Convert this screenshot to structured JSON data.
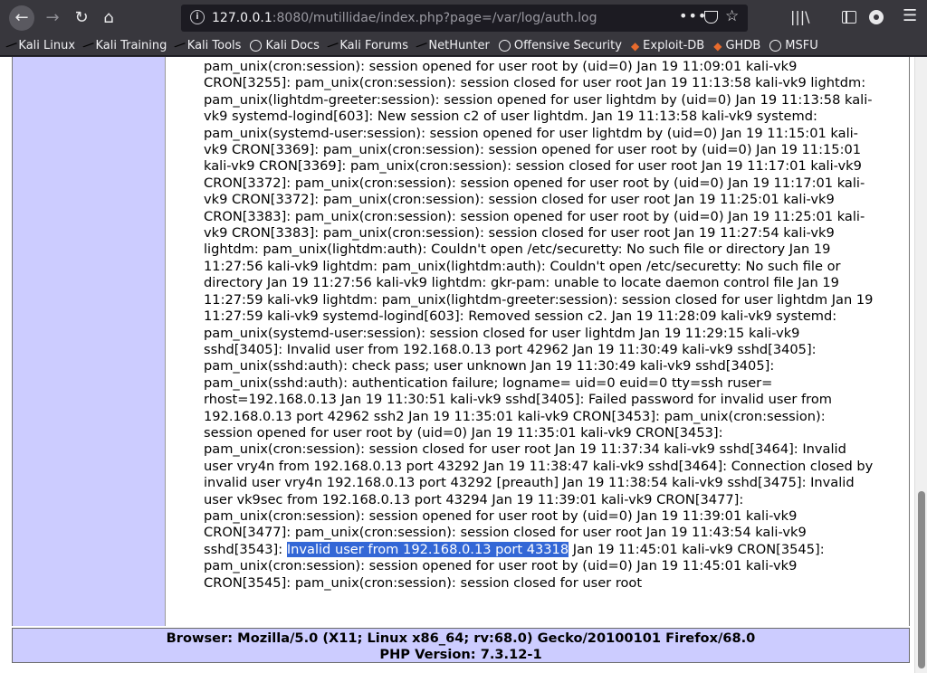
{
  "browser": {
    "url_host": "127.0.0.1",
    "url_rest": ":8080/mutillidae/index.php?page=/var/log/auth.log",
    "more_label": "•••"
  },
  "bookmarks": [
    {
      "label": "Kali Linux",
      "icon": "kali-dragon-icon"
    },
    {
      "label": "Kali Training",
      "icon": "kali-dragon-icon"
    },
    {
      "label": "Kali Tools",
      "icon": "kali-dragon-icon"
    },
    {
      "label": "Kali Docs",
      "icon": "globe-icon"
    },
    {
      "label": "Kali Forums",
      "icon": "kali-dragon-icon"
    },
    {
      "label": "NetHunter",
      "icon": "kali-dragon-icon"
    },
    {
      "label": "Offensive Security",
      "icon": "globe-icon"
    },
    {
      "label": "Exploit-DB",
      "icon": "exploit-db-icon"
    },
    {
      "label": "GHDB",
      "icon": "exploit-db-icon"
    },
    {
      "label": "MSFU",
      "icon": "globe-icon"
    }
  ],
  "log": {
    "before_highlight": "pam_unix(cron:session): session opened for user root by (uid=0) Jan 19 11:09:01 kali-vk9 CRON[3255]: pam_unix(cron:session): session closed for user root Jan 19 11:13:58 kali-vk9 lightdm: pam_unix(lightdm-greeter:session): session opened for user lightdm by (uid=0) Jan 19 11:13:58 kali-vk9 systemd-logind[603]: New session c2 of user lightdm. Jan 19 11:13:58 kali-vk9 systemd: pam_unix(systemd-user:session): session opened for user lightdm by (uid=0) Jan 19 11:15:01 kali-vk9 CRON[3369]: pam_unix(cron:session): session opened for user root by (uid=0) Jan 19 11:15:01 kali-vk9 CRON[3369]: pam_unix(cron:session): session closed for user root Jan 19 11:17:01 kali-vk9 CRON[3372]: pam_unix(cron:session): session opened for user root by (uid=0) Jan 19 11:17:01 kali-vk9 CRON[3372]: pam_unix(cron:session): session closed for user root Jan 19 11:25:01 kali-vk9 CRON[3383]: pam_unix(cron:session): session opened for user root by (uid=0) Jan 19 11:25:01 kali-vk9 CRON[3383]: pam_unix(cron:session): session closed for user root Jan 19 11:27:54 kali-vk9 lightdm: pam_unix(lightdm:auth): Couldn't open /etc/securetty: No such file or directory Jan 19 11:27:56 kali-vk9 lightdm: pam_unix(lightdm:auth): Couldn't open /etc/securetty: No such file or directory Jan 19 11:27:56 kali-vk9 lightdm: gkr-pam: unable to locate daemon control file Jan 19 11:27:59 kali-vk9 lightdm: pam_unix(lightdm-greeter:session): session closed for user lightdm Jan 19 11:27:59 kali-vk9 systemd-logind[603]: Removed session c2. Jan 19 11:28:09 kali-vk9 systemd: pam_unix(systemd-user:session): session closed for user lightdm Jan 19 11:29:15 kali-vk9 sshd[3405]: Invalid user from 192.168.0.13 port 42962 Jan 19 11:30:49 kali-vk9 sshd[3405]: pam_unix(sshd:auth): check pass; user unknown Jan 19 11:30:49 kali-vk9 sshd[3405]: pam_unix(sshd:auth): authentication failure; logname= uid=0 euid=0 tty=ssh ruser= rhost=192.168.0.13 Jan 19 11:30:51 kali-vk9 sshd[3405]: Failed password for invalid user from 192.168.0.13 port 42962 ssh2 Jan 19 11:35:01 kali-vk9 CRON[3453]: pam_unix(cron:session): session opened for user root by (uid=0) Jan 19 11:35:01 kali-vk9 CRON[3453]: pam_unix(cron:session): session closed for user root Jan 19 11:37:34 kali-vk9 sshd[3464]: Invalid user vry4n from 192.168.0.13 port 43292 Jan 19 11:38:47 kali-vk9 sshd[3464]: Connection closed by invalid user vry4n 192.168.0.13 port 43292 [preauth] Jan 19 11:38:54 kali-vk9 sshd[3475]: Invalid user vk9sec from 192.168.0.13 port 43294 Jan 19 11:39:01 kali-vk9 CRON[3477]: pam_unix(cron:session): session opened for user root by (uid=0) Jan 19 11:39:01 kali-vk9 CRON[3477]: pam_unix(cron:session): session closed for user root Jan 19 11:43:54 kali-vk9 sshd[3543]: ",
    "highlight": "Invalid user from 192.168.0.13 port 43318",
    "after_highlight": " Jan 19 11:45:01 kali-vk9 CRON[3545]: pam_unix(cron:session): session opened for user root by (uid=0) Jan 19 11:45:01 kali-vk9 CRON[3545]: pam_unix(cron:session): session closed for user root"
  },
  "footer": {
    "browser_line": "Browser: Mozilla/5.0 (X11; Linux x86_64; rv:68.0) Gecko/20100101 Firefox/68.0",
    "php_line": "PHP Version: 7.3.12-1"
  },
  "colors": {
    "toolbar": "#38373d",
    "sidebar_panel": "#ccccff",
    "selection": "#3367d6"
  }
}
